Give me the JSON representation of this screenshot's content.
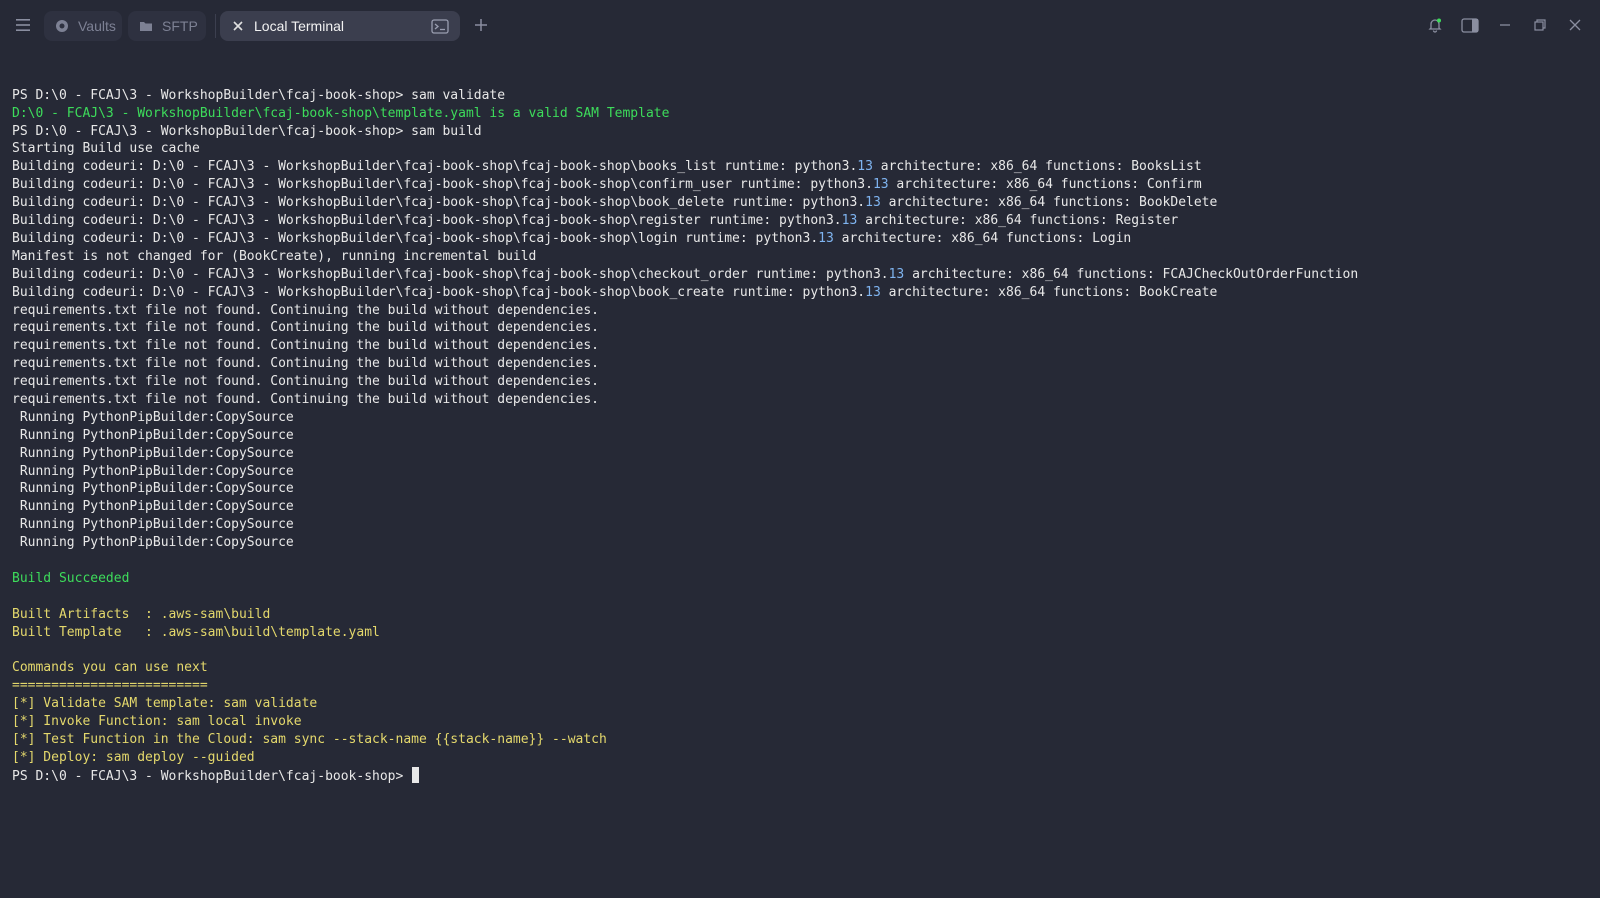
{
  "toolbar": {
    "tabs": [
      {
        "label": "Vaults",
        "icon": "vault-icon"
      },
      {
        "label": "SFTP",
        "icon": "folder-icon"
      },
      {
        "label": "Local Terminal",
        "icon": "close-icon"
      }
    ]
  },
  "terminal": {
    "lines": [
      {
        "text": "PS D:\\0 - FCAJ\\3 - WorkshopBuilder\\fcaj-book-shop> sam validate",
        "color": "default"
      },
      {
        "text": "D:\\0 - FCAJ\\3 - WorkshopBuilder\\fcaj-book-shop\\template.yaml is a valid SAM Template",
        "color": "green"
      },
      {
        "text": "PS D:\\0 - FCAJ\\3 - WorkshopBuilder\\fcaj-book-shop> sam build",
        "color": "default"
      },
      {
        "text": "Starting Build use cache",
        "color": "default"
      },
      {
        "text": "Building codeuri: D:\\0 - FCAJ\\3 - WorkshopBuilder\\fcaj-book-shop\\fcaj-book-shop\\books_list runtime: python3.13 architecture: x86_64 functions: BooksList",
        "color": "default"
      },
      {
        "text": "Building codeuri: D:\\0 - FCAJ\\3 - WorkshopBuilder\\fcaj-book-shop\\fcaj-book-shop\\confirm_user runtime: python3.13 architecture: x86_64 functions: Confirm",
        "color": "default"
      },
      {
        "text": "Building codeuri: D:\\0 - FCAJ\\3 - WorkshopBuilder\\fcaj-book-shop\\fcaj-book-shop\\book_delete runtime: python3.13 architecture: x86_64 functions: BookDelete",
        "color": "default"
      },
      {
        "text": "Building codeuri: D:\\0 - FCAJ\\3 - WorkshopBuilder\\fcaj-book-shop\\fcaj-book-shop\\register runtime: python3.13 architecture: x86_64 functions: Register",
        "color": "default"
      },
      {
        "text": "Building codeuri: D:\\0 - FCAJ\\3 - WorkshopBuilder\\fcaj-book-shop\\fcaj-book-shop\\login runtime: python3.13 architecture: x86_64 functions: Login",
        "color": "default"
      },
      {
        "text": "Manifest is not changed for (BookCreate), running incremental build",
        "color": "default"
      },
      {
        "text": "Building codeuri: D:\\0 - FCAJ\\3 - WorkshopBuilder\\fcaj-book-shop\\fcaj-book-shop\\checkout_order runtime: python3.13 architecture: x86_64 functions: FCAJCheckOutOrderFunction",
        "color": "default"
      },
      {
        "text": "Building codeuri: D:\\0 - FCAJ\\3 - WorkshopBuilder\\fcaj-book-shop\\fcaj-book-shop\\book_create runtime: python3.13 architecture: x86_64 functions: BookCreate",
        "color": "default"
      },
      {
        "text": "requirements.txt file not found. Continuing the build without dependencies.",
        "color": "default"
      },
      {
        "text": "requirements.txt file not found. Continuing the build without dependencies.",
        "color": "default"
      },
      {
        "text": "requirements.txt file not found. Continuing the build without dependencies.",
        "color": "default"
      },
      {
        "text": "requirements.txt file not found. Continuing the build without dependencies.",
        "color": "default"
      },
      {
        "text": "requirements.txt file not found. Continuing the build without dependencies.",
        "color": "default"
      },
      {
        "text": "requirements.txt file not found. Continuing the build without dependencies.",
        "color": "default"
      },
      {
        "text": " Running PythonPipBuilder:CopySource",
        "color": "default"
      },
      {
        "text": " Running PythonPipBuilder:CopySource",
        "color": "default"
      },
      {
        "text": " Running PythonPipBuilder:CopySource",
        "color": "default"
      },
      {
        "text": " Running PythonPipBuilder:CopySource",
        "color": "default"
      },
      {
        "text": " Running PythonPipBuilder:CopySource",
        "color": "default"
      },
      {
        "text": " Running PythonPipBuilder:CopySource",
        "color": "default"
      },
      {
        "text": " Running PythonPipBuilder:CopySource",
        "color": "default"
      },
      {
        "text": " Running PythonPipBuilder:CopySource",
        "color": "default"
      },
      {
        "text": "",
        "color": "default"
      },
      {
        "text": "Build Succeeded",
        "color": "green"
      },
      {
        "text": "",
        "color": "default"
      },
      {
        "text": "Built Artifacts  : .aws-sam\\build",
        "color": "yellow"
      },
      {
        "text": "Built Template   : .aws-sam\\build\\template.yaml",
        "color": "yellow"
      },
      {
        "text": "",
        "color": "default"
      },
      {
        "text": "Commands you can use next",
        "color": "yellow"
      },
      {
        "text": "=========================",
        "color": "yellow"
      },
      {
        "text": "[*] Validate SAM template: sam validate",
        "color": "yellow"
      },
      {
        "text": "[*] Invoke Function: sam local invoke",
        "color": "yellow"
      },
      {
        "text": "[*] Test Function in the Cloud: sam sync --stack-name {{stack-name}} --watch",
        "color": "yellow"
      },
      {
        "text": "[*] Deploy: sam deploy --guided",
        "color": "yellow"
      }
    ],
    "prompt": "PS D:\\0 - FCAJ\\3 - WorkshopBuilder\\fcaj-book-shop> "
  },
  "colors": {
    "background": "#262936",
    "green": "#3ddc5b",
    "yellow": "#e4d86c",
    "number": "#7fb4f0"
  }
}
